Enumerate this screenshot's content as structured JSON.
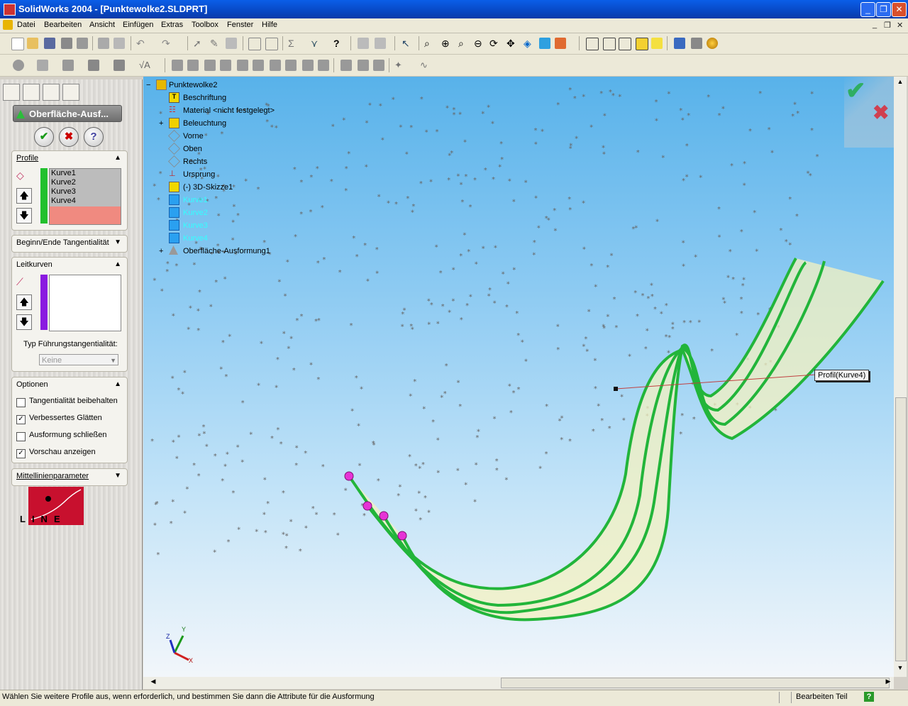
{
  "window": {
    "title": "SolidWorks 2004 - [Punktewolke2.SLDPRT]"
  },
  "menu": [
    "Datei",
    "Bearbeiten",
    "Ansicht",
    "Einfügen",
    "Extras",
    "Toolbox",
    "Fenster",
    "Hilfe"
  ],
  "feature": {
    "name": "Oberfläche-Ausf...",
    "profile_header": "Profile",
    "profiles": [
      "Kurve1",
      "Kurve2",
      "Kurve3",
      "Kurve4"
    ],
    "tangency_header": "Beginn/Ende Tangentialität",
    "guides_header": "Leitkurven",
    "guide_tangency_label": "Typ Führungstangentialität:",
    "guide_tangency_value": "Keine",
    "options_header": "Optionen",
    "options": [
      {
        "label": "Tangentialität beibehalten",
        "checked": false
      },
      {
        "label": "Verbessertes Glätten",
        "checked": true
      },
      {
        "label": "Ausformung schließen",
        "checked": false
      },
      {
        "label": "Vorschau anzeigen",
        "checked": true
      }
    ],
    "centerline_header": "Mittellinienparameter",
    "logo_text": "LINE"
  },
  "tree": {
    "root": "Punktewolke2",
    "items": [
      "Beschriftung",
      "Material <nicht festgelegt>",
      "Beleuchtung",
      "Vorne",
      "Oben",
      "Rechts",
      "Ursprung",
      "(-) 3D-Skizze1",
      "Kurve1",
      "Kurve2",
      "Kurve3",
      "Kurve4",
      "Oberfläche-Ausformung1"
    ]
  },
  "viewport": {
    "callout": "Profil(Kurve4)",
    "axes": {
      "x": "X",
      "y": "Y",
      "z": "Z"
    }
  },
  "status": {
    "message": "Wählen Sie weitere Profile aus, wenn erforderlich, und bestimmen Sie dann die Attribute für die Ausformung",
    "mode": "Bearbeiten Teil",
    "help": "?"
  },
  "colors": {
    "accent_green": "#22b53a",
    "titlebar": "#0a5ee8",
    "sky_top": "#58b2ea",
    "handle": "#e633d6"
  }
}
